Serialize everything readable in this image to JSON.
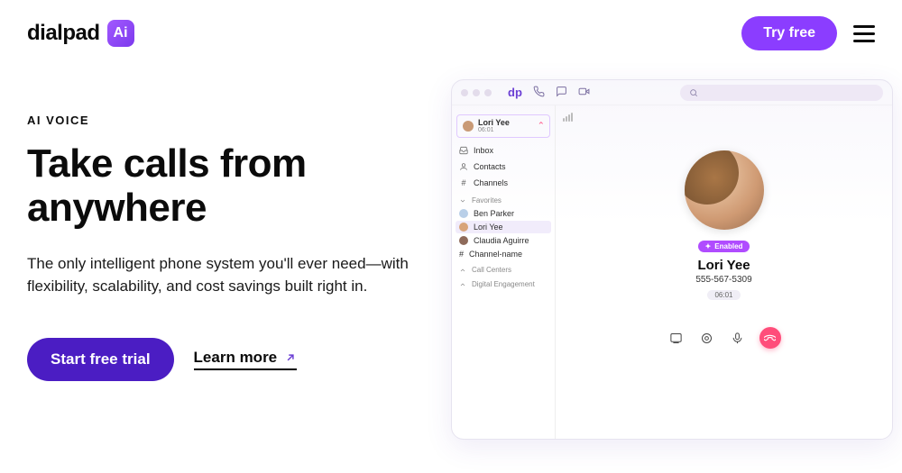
{
  "header": {
    "brand_word": "dialpad",
    "brand_chip": "Ai",
    "try_free": "Try free"
  },
  "hero": {
    "eyebrow": "AI VOICE",
    "title_line1": "Take calls from",
    "title_line2": "anywhere",
    "description": "The only intelligent phone system you'll ever need—with flexibility, scalability, and cost savings built right in.",
    "start_trial": "Start free trial",
    "learn_more": "Learn more"
  },
  "app": {
    "search_placeholder": "",
    "active_call": {
      "name": "Lori Yee",
      "time": "06:01"
    },
    "nav": {
      "inbox": "Inbox",
      "contacts": "Contacts",
      "channels": "Channels"
    },
    "sections": {
      "favorites": "Favorites",
      "call_centers": "Call Centers",
      "digital_engagement": "Digital Engagement"
    },
    "favorites": [
      {
        "name": "Ben Parker",
        "avatar_color": "#b9cfe8"
      },
      {
        "name": "Lori Yee",
        "avatar_color": "#d8a47a"
      },
      {
        "name": "Claudia Aguirre",
        "avatar_color": "#8e6a5a"
      },
      {
        "name": "Channel-name",
        "avatar_color": ""
      }
    ],
    "call_card": {
      "enabled_badge": "Enabled",
      "name": "Lori Yee",
      "phone": "555-567-5309",
      "duration": "06:01"
    }
  }
}
